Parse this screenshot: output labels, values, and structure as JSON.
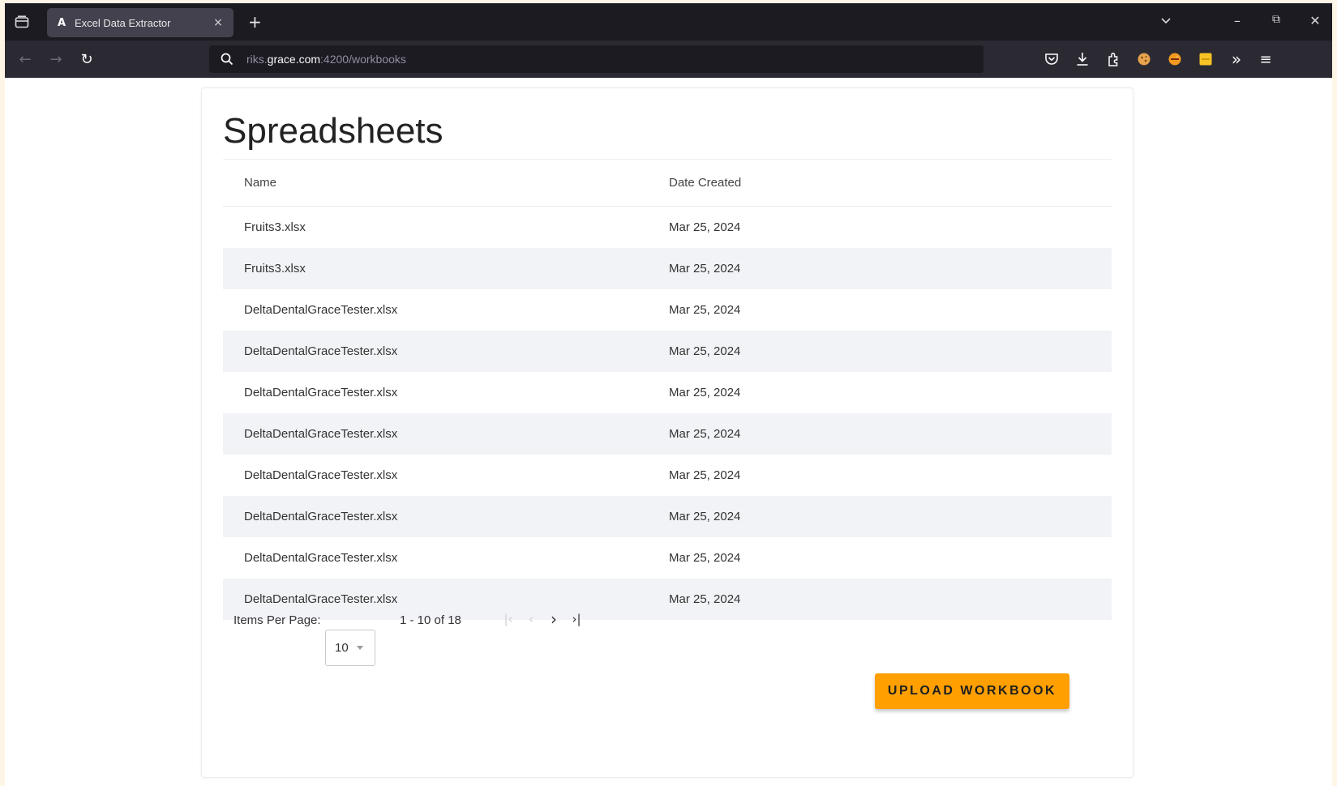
{
  "browser": {
    "tab_title": "Excel Data Extractor",
    "tab_close": "×",
    "new_tab": "+",
    "url_prefix": "riks.",
    "url_host": "grace.com",
    "url_suffix": ":4200/workbooks",
    "window_controls": {
      "list_all_tabs": "⌄",
      "minimize": "–",
      "restore": "⧉",
      "close": "✕"
    },
    "nav": {
      "back": "←",
      "forward": "→",
      "reload": "↻"
    },
    "toolbar": {
      "overflow": "»",
      "menu": "≡"
    }
  },
  "page": {
    "title": "Spreadsheets",
    "table": {
      "columns": [
        "Name",
        "Date Created"
      ],
      "rows": [
        {
          "name": "Fruits3.xlsx",
          "date": "Mar 25, 2024"
        },
        {
          "name": "Fruits3.xlsx",
          "date": "Mar 25, 2024"
        },
        {
          "name": "DeltaDentalGraceTester.xlsx",
          "date": "Mar 25, 2024"
        },
        {
          "name": "DeltaDentalGraceTester.xlsx",
          "date": "Mar 25, 2024"
        },
        {
          "name": "DeltaDentalGraceTester.xlsx",
          "date": "Mar 25, 2024"
        },
        {
          "name": "DeltaDentalGraceTester.xlsx",
          "date": "Mar 25, 2024"
        },
        {
          "name": "DeltaDentalGraceTester.xlsx",
          "date": "Mar 25, 2024"
        },
        {
          "name": "DeltaDentalGraceTester.xlsx",
          "date": "Mar 25, 2024"
        },
        {
          "name": "DeltaDentalGraceTester.xlsx",
          "date": "Mar 25, 2024"
        },
        {
          "name": "DeltaDentalGraceTester.xlsx",
          "date": "Mar 25, 2024"
        }
      ]
    },
    "paginator": {
      "items_per_page_label": "Items Per Page:",
      "items_per_page_value": "10",
      "range_label": "1 - 10 of 18",
      "first": "|‹",
      "prev": "‹",
      "next": "›",
      "last": "›|"
    },
    "upload_button": "UPLOAD WORKBOOK"
  },
  "colors": {
    "accent": "#ffa000",
    "row_alt": "#f1f3f6",
    "chrome_dark": "#1c1b22"
  }
}
